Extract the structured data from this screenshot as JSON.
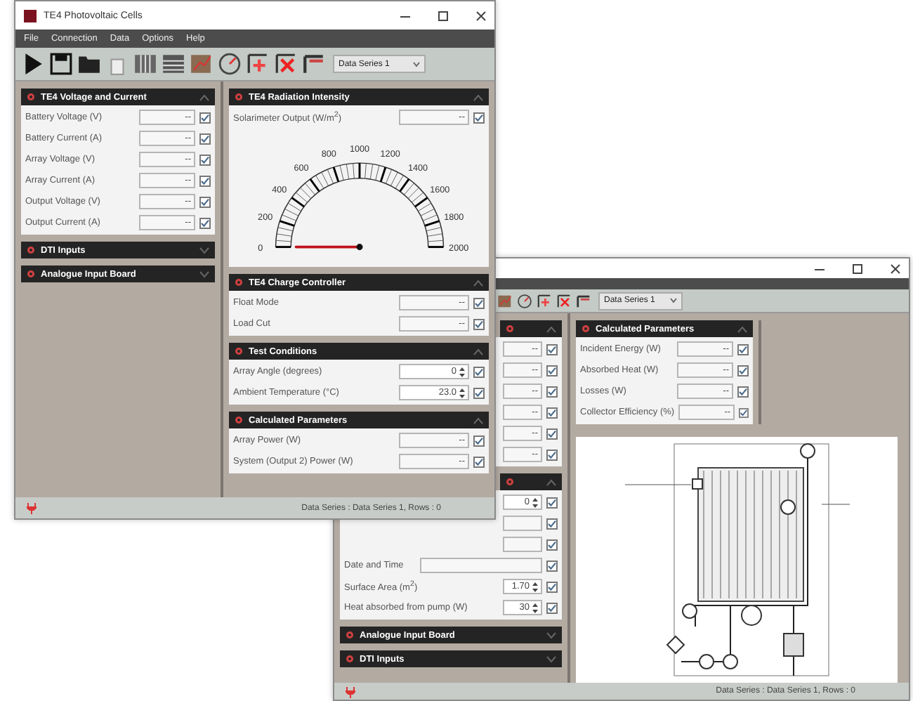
{
  "front_window": {
    "title": "TE4 Photovoltaic Cells",
    "menu": [
      "File",
      "Connection",
      "Data",
      "Options",
      "Help"
    ],
    "series_dropdown": "Data Series 1",
    "left_panels": [
      {
        "title": "TE4 Voltage and Current",
        "expanded": true,
        "rows": [
          {
            "label": "Battery Voltage (V)",
            "kind": "readout",
            "value": "--",
            "checked": true
          },
          {
            "label": "Battery Current (A)",
            "kind": "readout",
            "value": "--",
            "checked": true
          },
          {
            "label": "Array Voltage (V)",
            "kind": "readout",
            "value": "--",
            "checked": true
          },
          {
            "label": "Array Current (A)",
            "kind": "readout",
            "value": "--",
            "checked": true
          },
          {
            "label": "Output Voltage (V)",
            "kind": "readout",
            "value": "--",
            "checked": true
          },
          {
            "label": "Output Current (A)",
            "kind": "readout",
            "value": "--",
            "checked": true
          }
        ]
      },
      {
        "title": "DTI Inputs",
        "expanded": false
      },
      {
        "title": "Analogue Input Board",
        "expanded": false
      }
    ],
    "right_panels": [
      {
        "title": "TE4 Radiation Intensity",
        "expanded": true,
        "rows": [
          {
            "label": "Solarimeter Output (W/m$^{2}$)",
            "kind": "readout",
            "value": "--",
            "checked": true
          }
        ],
        "gauge": {
          "labels": [
            "0",
            "200",
            "400",
            "600",
            "800",
            "1000",
            "1200",
            "1400",
            "1600",
            "1800",
            "2000"
          ],
          "level": 0
        }
      },
      {
        "title": "TE4 Charge Controller",
        "expanded": true,
        "rows": [
          {
            "label": "Float Mode",
            "kind": "readout",
            "value": "--",
            "checked": true
          },
          {
            "label": "Load Cut",
            "kind": "readout",
            "value": "--",
            "checked": true
          }
        ]
      },
      {
        "title": "Test Conditions",
        "expanded": true,
        "rows": [
          {
            "label": "Array Angle (degrees)",
            "kind": "spin",
            "value": "0",
            "checked": true
          },
          {
            "label": "Ambient Temperature (°C)",
            "kind": "spin",
            "value": "23.0",
            "checked": true
          }
        ]
      },
      {
        "title": "Calculated Parameters",
        "expanded": true,
        "rows": [
          {
            "label": "Array Power (W)",
            "kind": "readout",
            "value": "--",
            "checked": true
          },
          {
            "label": "System (Output 2) Power (W)",
            "kind": "readout",
            "value": "--",
            "checked": true
          }
        ]
      }
    ],
    "status": "Data Series : Data Series 1, Rows : 0"
  },
  "back_window": {
    "series_dropdown": "Data Series 1",
    "left_panels": [
      {
        "expanded": true,
        "rows": [
          {
            "kind": "readout",
            "value": "--",
            "checked": true
          },
          {
            "kind": "readout",
            "value": "--",
            "checked": true
          },
          {
            "kind": "readout",
            "value": "--",
            "checked": true
          },
          {
            "kind": "readout",
            "value": "--",
            "checked": true
          },
          {
            "kind": "readout",
            "value": "--",
            "checked": true
          },
          {
            "kind": "readout",
            "value": "--",
            "checked": true
          }
        ]
      },
      {
        "expanded": true,
        "rows": [
          {
            "kind": "spin",
            "value": "0",
            "checked": true
          },
          {
            "kind": "text",
            "checked": true
          },
          {
            "kind": "text",
            "checked": true
          },
          {
            "label": "Date and Time",
            "kind": "text",
            "checked": true
          },
          {
            "label": "Surface Area (m$^{2}$)",
            "kind": "spin",
            "value": "1.70",
            "checked": true
          },
          {
            "label": "Heat absorbed from pump (W)",
            "kind": "spin",
            "value": "30",
            "checked": true
          }
        ]
      },
      {
        "title": "Analogue Input Board",
        "expanded": false
      },
      {
        "title": "DTI Inputs",
        "expanded": false
      }
    ],
    "right_panels": [
      {
        "title": "Calculated Parameters",
        "expanded": true,
        "rows": [
          {
            "label": "Incident Energy (W)",
            "kind": "readout",
            "value": "--",
            "checked": true
          },
          {
            "label": "Absorbed Heat (W)",
            "kind": "readout",
            "value": "--",
            "checked": true
          },
          {
            "label": "Losses (W)",
            "kind": "readout",
            "value": "--",
            "checked": true
          },
          {
            "label": "Collector Efficiency (%)",
            "kind": "readout",
            "value": "--",
            "checked": true
          }
        ]
      }
    ],
    "status": "Data Series : Data Series 1, Rows : 0"
  }
}
